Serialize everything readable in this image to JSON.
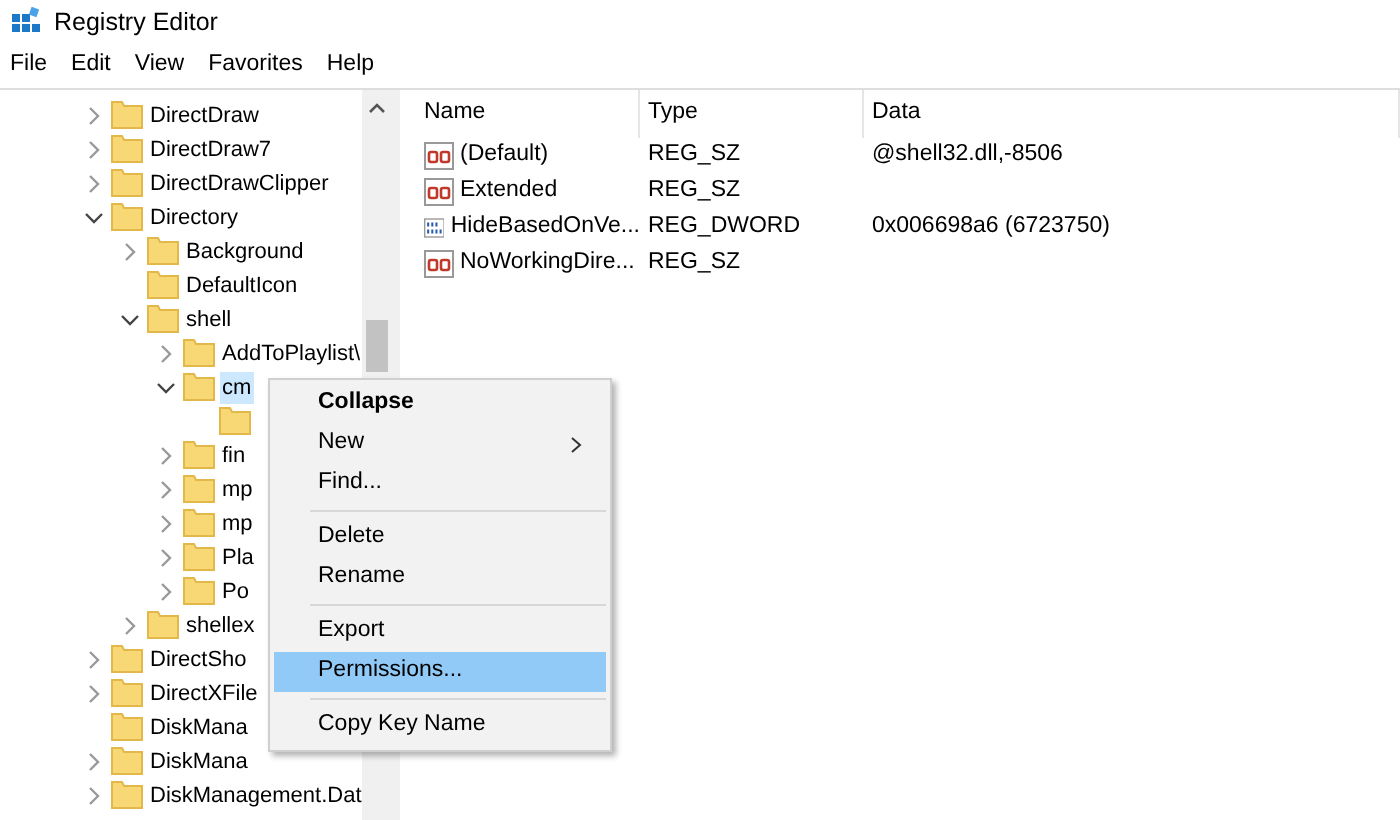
{
  "window": {
    "title": "Registry Editor"
  },
  "menu_bar": [
    "File",
    "Edit",
    "View",
    "Favorites",
    "Help"
  ],
  "tree": [
    {
      "label": "DirectDraw",
      "kind": "branch",
      "expanded": false,
      "selected": false
    },
    {
      "label": "DirectDraw7",
      "kind": "branch",
      "expanded": false,
      "selected": false
    },
    {
      "label": "DirectDrawClipper",
      "kind": "branch",
      "expanded": false,
      "selected": false
    },
    {
      "label": "Directory",
      "kind": "branch",
      "expanded": true,
      "selected": false,
      "children": [
        {
          "label": "Background",
          "kind": "branch",
          "expanded": false,
          "selected": false
        },
        {
          "label": "DefaultIcon",
          "kind": "leaf",
          "selected": false
        },
        {
          "label": "shell",
          "kind": "branch",
          "expanded": true,
          "selected": false,
          "children": [
            {
              "label": "AddToPlaylist\\",
              "kind": "branch",
              "expanded": false,
              "selected": false
            },
            {
              "label": "cm",
              "kind": "branch",
              "expanded": true,
              "selected": true,
              "children": [
                {
                  "kind": "leaf",
                  "selected": false
                }
              ]
            },
            {
              "label": "fin",
              "kind": "branch",
              "expanded": false,
              "selected": false
            },
            {
              "label": "mp",
              "kind": "branch",
              "expanded": false,
              "selected": false
            },
            {
              "label": "mp",
              "kind": "branch",
              "expanded": false,
              "selected": false
            },
            {
              "label": "Pla",
              "kind": "branch",
              "expanded": false,
              "selected": false
            },
            {
              "label": "Po",
              "kind": "branch",
              "expanded": false,
              "selected": false
            }
          ]
        },
        {
          "label": "shellex",
          "kind": "branch",
          "expanded": false,
          "selected": false
        }
      ]
    },
    {
      "label": "DirectSho",
      "kind": "branch",
      "expanded": false,
      "selected": false
    },
    {
      "label": "DirectXFile",
      "kind": "branch",
      "expanded": false,
      "selected": false
    },
    {
      "label": "DiskMana",
      "kind": "leaf",
      "selected": false
    },
    {
      "label": "DiskMana",
      "kind": "branch",
      "expanded": false,
      "selected": false
    },
    {
      "label": "DiskManagement.Dat",
      "kind": "branch",
      "expanded": false,
      "selected": false
    }
  ],
  "values": {
    "columns": [
      "Name",
      "Type",
      "Data"
    ],
    "rows": [
      {
        "kind": "string",
        "name": "(Default)",
        "type": "REG_SZ",
        "data": "@shell32.dll,-8506"
      },
      {
        "kind": "string",
        "name": "Extended",
        "type": "REG_SZ",
        "data": ""
      },
      {
        "kind": "binary",
        "name": "HideBasedOnVe...",
        "type": "REG_DWORD",
        "data": "0x006698a6 (6723750)"
      },
      {
        "kind": "string",
        "name": "NoWorkingDire...",
        "type": "REG_SZ",
        "data": ""
      }
    ]
  },
  "context_menu": [
    {
      "kind": "item",
      "label": "Collapse",
      "default": true,
      "submenu": false,
      "selected": false
    },
    {
      "kind": "item",
      "label": "New",
      "default": false,
      "submenu": true,
      "selected": false
    },
    {
      "kind": "item",
      "label": "Find...",
      "default": false,
      "submenu": false,
      "selected": false
    },
    {
      "kind": "separator"
    },
    {
      "kind": "item",
      "label": "Delete",
      "default": false,
      "submenu": false,
      "selected": false
    },
    {
      "kind": "item",
      "label": "Rename",
      "default": false,
      "submenu": false,
      "selected": false
    },
    {
      "kind": "separator"
    },
    {
      "kind": "item",
      "label": "Export",
      "default": false,
      "submenu": false,
      "selected": false
    },
    {
      "kind": "item",
      "label": "Permissions...",
      "default": false,
      "submenu": false,
      "selected": true
    },
    {
      "kind": "separator"
    },
    {
      "kind": "item",
      "label": "Copy Key Name",
      "default": false,
      "submenu": false,
      "selected": false
    }
  ]
}
